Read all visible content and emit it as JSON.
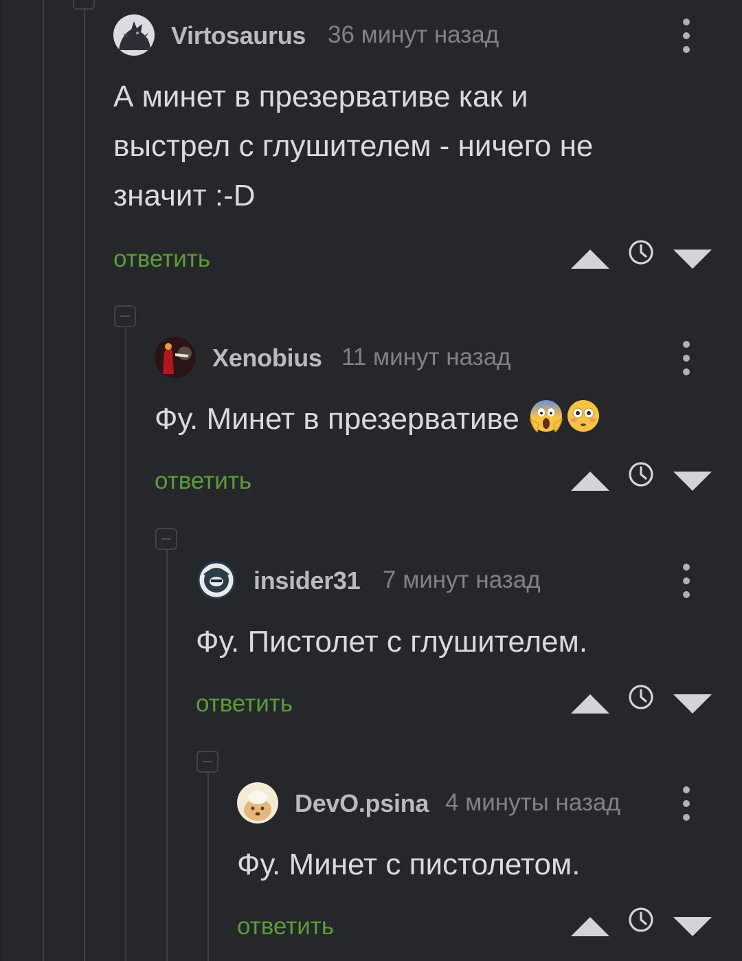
{
  "comments": [
    {
      "username": "Virtosaurus",
      "time": "36 минут назад",
      "lines": [
        "А минет в презервативе как и",
        "выстрел с глушителем - ничего не",
        "значит :-D"
      ],
      "reply_label": "ответить",
      "avatar_icon": "dragon-avatar-icon"
    },
    {
      "username": "Xenobius",
      "time": "11 минут назад",
      "text": "Фу. Минет в презервативе",
      "emojis": [
        "😱",
        "😳"
      ],
      "reply_label": "ответить",
      "avatar_icon": "red-figure-avatar-icon"
    },
    {
      "username": "insider31",
      "time": "7 минут назад",
      "text": "Фу. Пистолет с глушителем.",
      "reply_label": "ответить",
      "avatar_icon": "league-badge-avatar-icon"
    },
    {
      "username": "DevO.psina",
      "time": "4 минуты назад",
      "text": "Фу. Минет с пистолетом.",
      "reply_label": "ответить",
      "avatar_icon": "dog-avatar-icon"
    }
  ],
  "colors": {
    "background": "#25272b",
    "reply_link": "#5c9c3a",
    "username": "#b9bbbe",
    "timestamp": "#7f8287",
    "thread_line": "#3a3d42"
  }
}
